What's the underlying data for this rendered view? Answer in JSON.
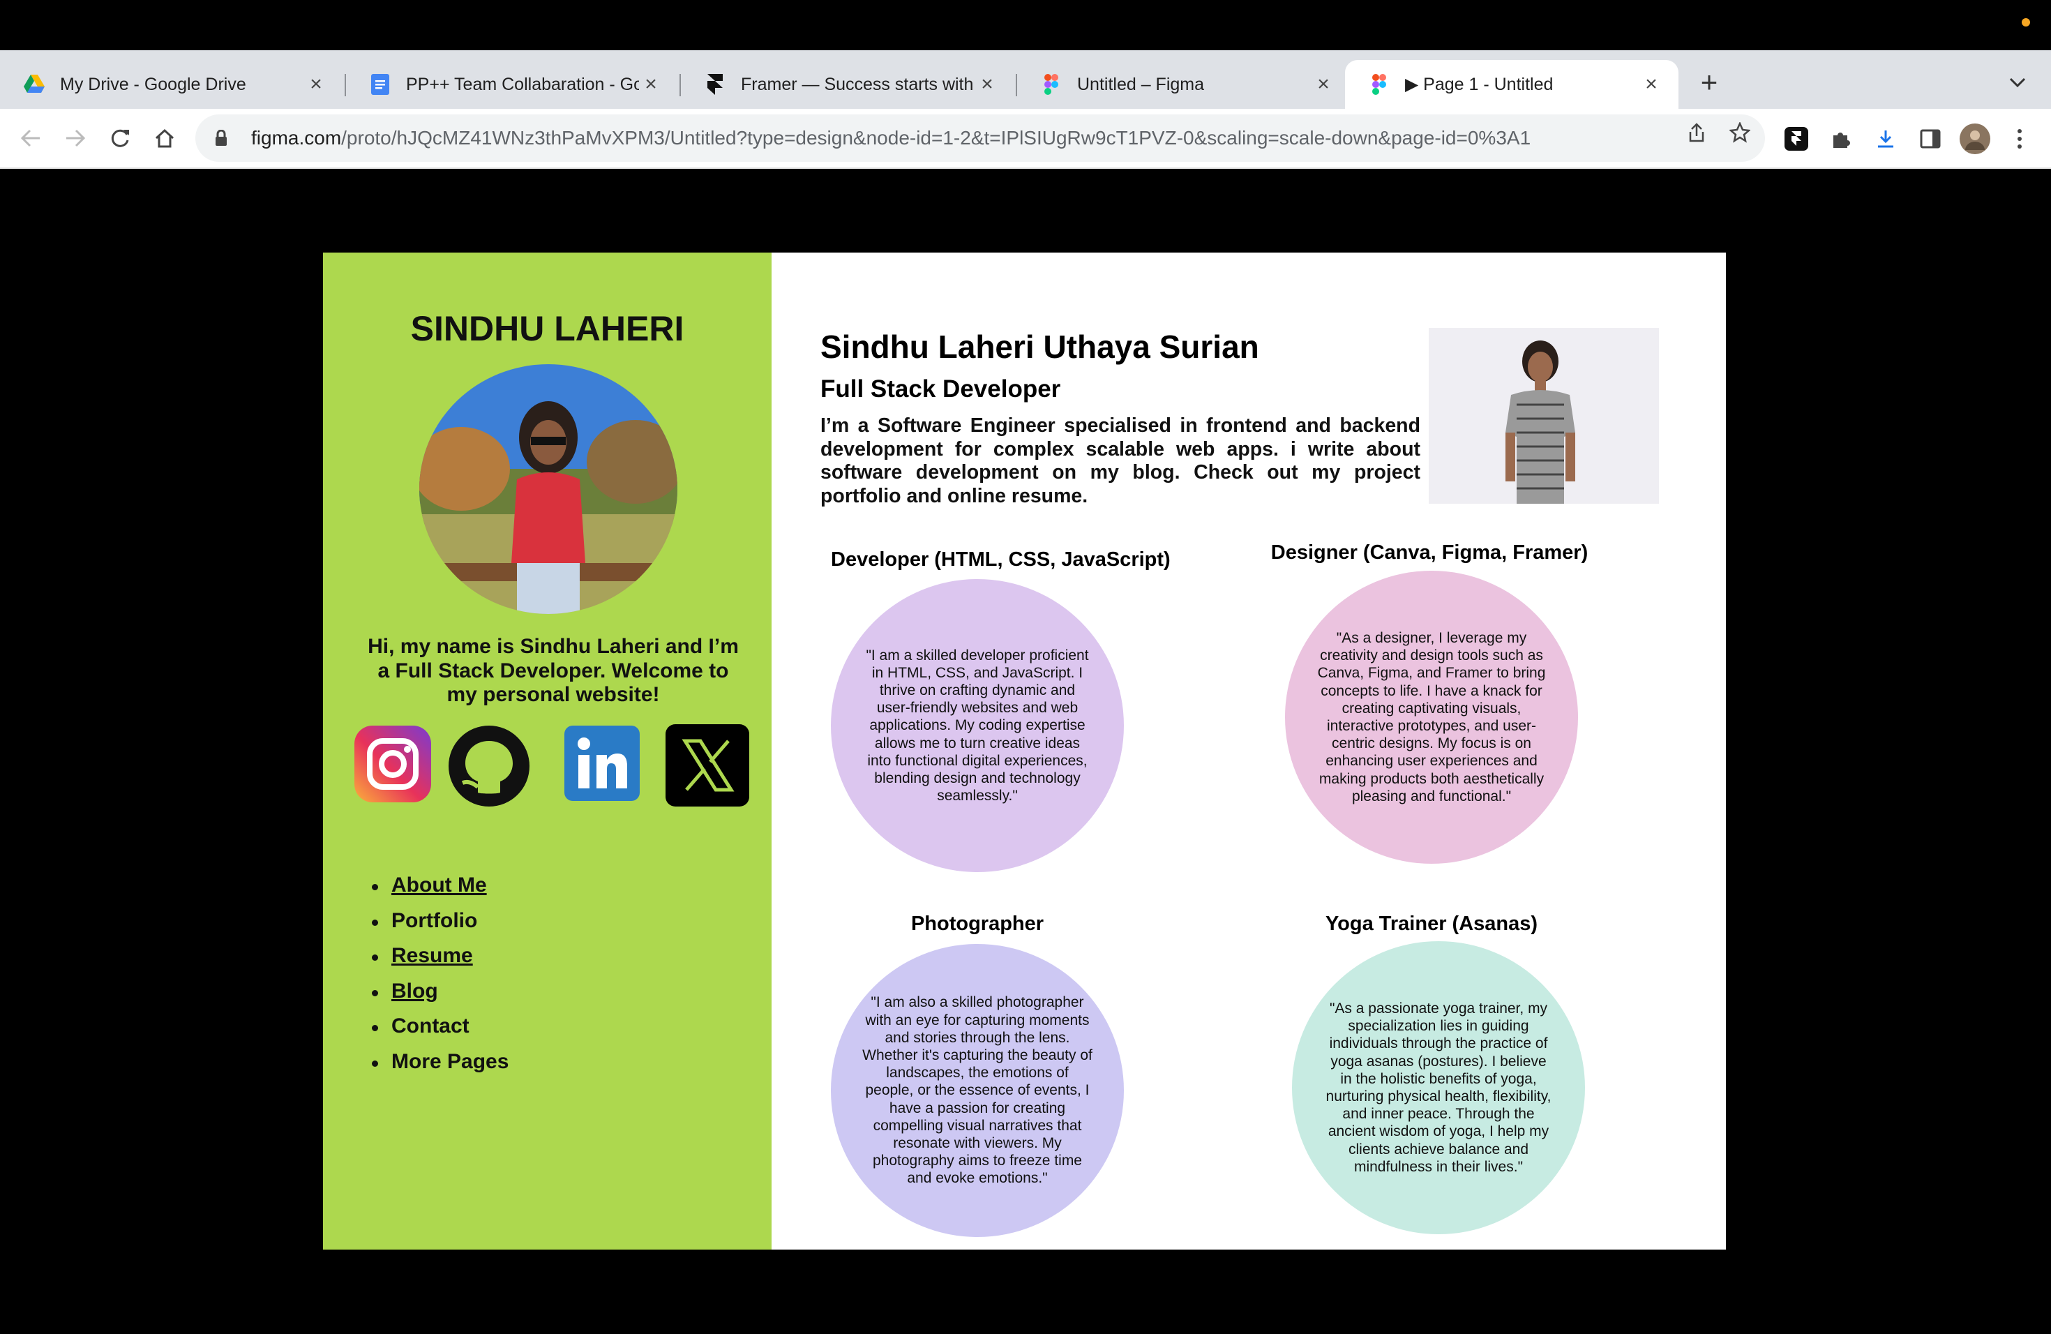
{
  "browser": {
    "tabs": [
      {
        "title": "My Drive - Google Drive",
        "icon": "google-drive-icon"
      },
      {
        "title": "PP++ Team Collabaration - Goo",
        "icon": "google-docs-icon"
      },
      {
        "title": "Framer — Success starts with a",
        "icon": "framer-icon"
      },
      {
        "title": "Untitled – Figma",
        "icon": "figma-icon"
      },
      {
        "title": "▶ Page 1 - Untitled",
        "icon": "figma-icon",
        "active": true
      }
    ],
    "url_host": "figma.com",
    "url_path": "/proto/hJQcMZ41WNz3thPaMvXPM3/Untitled?type=design&node-id=1-2&t=IPlSIUgRw9cT1PVZ-0&scaling=scale-down&page-id=0%3A1"
  },
  "sidebar": {
    "title": "SINDHU LAHERI",
    "intro": "Hi, my name is Sindhu Laheri and I’m a Full Stack Developer. Welcome to my personal website!",
    "social": [
      "instagram-icon",
      "github-icon",
      "linkedin-icon",
      "x-icon"
    ],
    "nav": [
      {
        "label": "About Me",
        "underlined": true
      },
      {
        "label": "Portfolio",
        "underlined": false
      },
      {
        "label": "Resume",
        "underlined": true
      },
      {
        "label": "Blog",
        "underlined": true
      },
      {
        "label": "Contact",
        "underlined": false
      },
      {
        "label": "More Pages",
        "underlined": false
      }
    ]
  },
  "main": {
    "name": "Sindhu Laheri Uthaya Surian",
    "role": "Full Stack Developer",
    "bio": "I’m a Software Engineer specialised in frontend and backend development for complex scalable web apps. i write about software development on my blog. Check out my project portfolio and online resume.",
    "skills": [
      {
        "title": "Developer (HTML, CSS, JavaScript)",
        "color": "#dcc6ef",
        "text": "\"I am a skilled developer proficient in HTML, CSS, and JavaScript. I thrive on crafting dynamic and user-friendly websites and web applications. My coding expertise allows me to turn creative ideas into functional digital experiences, blending design and technology seamlessly.\""
      },
      {
        "title": "Designer (Canva, Figma, Framer)",
        "color": "#ebc3df",
        "text": "\"As a designer, I leverage my creativity and design tools such as Canva, Figma, and Framer to bring concepts to life. I have a knack for creating captivating visuals, interactive prototypes, and user-centric designs. My focus is on enhancing user experiences and making products both aesthetically pleasing and functional.\""
      },
      {
        "title": "Photographer",
        "color": "#cdc8f3",
        "text": "\"I am also a skilled photographer with an eye for capturing moments and stories through the lens. Whether it's capturing the beauty of landscapes, the emotions of people, or the essence of events, I have a passion for creating compelling visual narratives that resonate with viewers. My photography aims to freeze time and evoke emotions.\""
      },
      {
        "title": "Yoga Trainer (Asanas)",
        "color": "#c7ebe2",
        "text": "\"As a passionate yoga trainer, my specialization lies in guiding individuals through the practice of yoga asanas (postures). I believe in the holistic benefits of yoga, nurturing physical health, flexibility, and inner peace. Through the ancient wisdom of yoga, I help my clients achieve balance and mindfulness in their lives.\""
      }
    ]
  },
  "colors": {
    "sidebar_bg": "#add84e",
    "tab_bg": "#dee1e6",
    "active_tab": "#ffffff"
  }
}
